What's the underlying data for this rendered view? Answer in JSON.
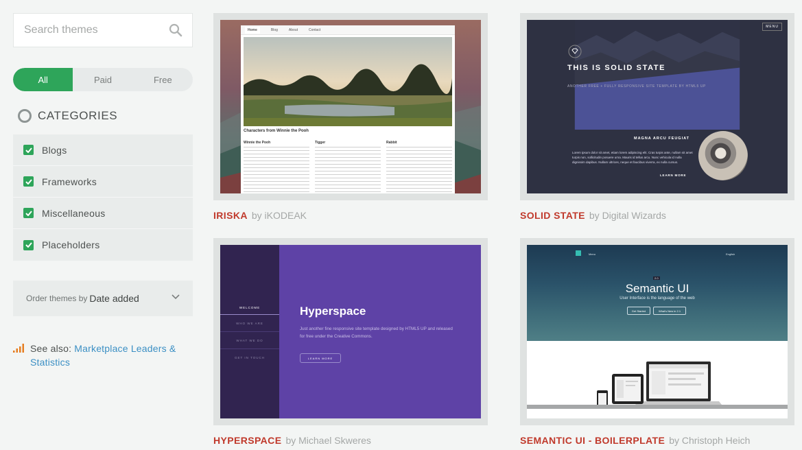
{
  "search": {
    "placeholder": "Search themes"
  },
  "pricing": {
    "options": [
      "All",
      "Paid",
      "Free"
    ],
    "selected": "All"
  },
  "categories": {
    "heading": "CATEGORIES",
    "items": [
      {
        "label": "Blogs",
        "checked": true
      },
      {
        "label": "Frameworks",
        "checked": true
      },
      {
        "label": "Miscellaneous",
        "checked": true
      },
      {
        "label": "Placeholders",
        "checked": true
      }
    ]
  },
  "order": {
    "prefix": "Order themes by",
    "value": "Date added"
  },
  "see_also": {
    "prefix": "See also:",
    "link": "Marketplace Leaders & Statistics"
  },
  "themes": [
    {
      "name": "IRISKA",
      "author": "by iKODEAK",
      "preview": {
        "nav": [
          "Home",
          "Blog",
          "About",
          "Contact"
        ],
        "heading": "Characters from Winnie the Pooh",
        "columns": [
          "Winnie the Pooh",
          "Tigger",
          "Rabbit"
        ]
      }
    },
    {
      "name": "SOLID STATE",
      "author": "by Digital Wizards",
      "preview": {
        "menu": "MENU",
        "title": "THIS IS SOLID STATE",
        "subtitle": "ANOTHER FREE + FULLY RESPONSIVE SITE TEMPLATE BY HTML5 UP",
        "section": "MAGNA ARCU FEUGIAT",
        "body": "Lorem ipsum dolor sit amet, etiam lorem adipiscing elit. Cras turpis ante, nullam sit amet turpis non, sollicitudin posuere urna. Mauris id tellus arcu. Nunc vehicula id nulla dignissim dapibus. Nullam ultrices, neque et faucibus viverra, ex nulla cursus.",
        "more": "LEARN MORE"
      }
    },
    {
      "name": "HYPERSPACE",
      "author": "by Michael Skweres",
      "preview": {
        "nav": [
          "WELCOME",
          "WHO WE ARE",
          "WHAT WE DO",
          "GET IN TOUCH"
        ],
        "title": "Hyperspace",
        "body": "Just another fine responsive site template designed by HTML5 UP and released for free under the Creative Commons.",
        "button": "LEARN MORE"
      }
    },
    {
      "name": "SEMANTIC UI - BOILERPLATE",
      "author": "by Christoph Heich",
      "preview": {
        "menu": "Menu",
        "lang": "English",
        "badge": "2.0",
        "title": "Semantic UI",
        "subtitle": "User Interface is the language of the web",
        "btn1": "Get Started",
        "btn2": "What's New in 2.1"
      }
    }
  ],
  "colors": {
    "accent_green": "#2ea55a",
    "theme_name_red": "#c0392b",
    "link_blue": "#3b8fc4"
  },
  "icons": {
    "search": "search-icon",
    "categories": "ring-icon",
    "order": "chevron-down-icon",
    "see_also": "signal-bars-icon"
  }
}
